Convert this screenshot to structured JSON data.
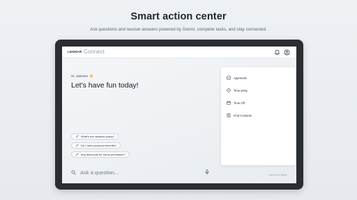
{
  "hero": {
    "title": "Smart action center",
    "subtitle": "Ask questions and receive answers powered by GenAI, complete tasks, and stay connected."
  },
  "appbar": {
    "brand": "LENNAR",
    "product": "Connect",
    "icons": [
      "bell-icon",
      "account-icon"
    ]
  },
  "main": {
    "greeting": "Hi, Jasmine",
    "greeting_emoji": "👋",
    "headline": "Let's have fun today!",
    "suggestions": [
      {
        "label": "What's the vacation policy?"
      },
      {
        "label": "Do I have personal benefits?"
      },
      {
        "label": "Any discounts for home purchases?"
      }
    ]
  },
  "panel": {
    "items": [
      {
        "label": "Approvals",
        "icon": "checkbox-icon"
      },
      {
        "label": "Time Entry",
        "icon": "clock-icon"
      },
      {
        "label": "Time Off",
        "icon": "calendar-icon"
      },
      {
        "label": "Find Contacts",
        "icon": "contact-card-icon"
      }
    ]
  },
  "search": {
    "placeholder": "Ask a question...",
    "footnote": "Internal use tagline"
  },
  "colors": {
    "tablet_frame": "#2a2d31",
    "screen_bg": "#eef1f4",
    "brand_text": "#1c2a3a",
    "product_text": "#8fa0b2"
  }
}
